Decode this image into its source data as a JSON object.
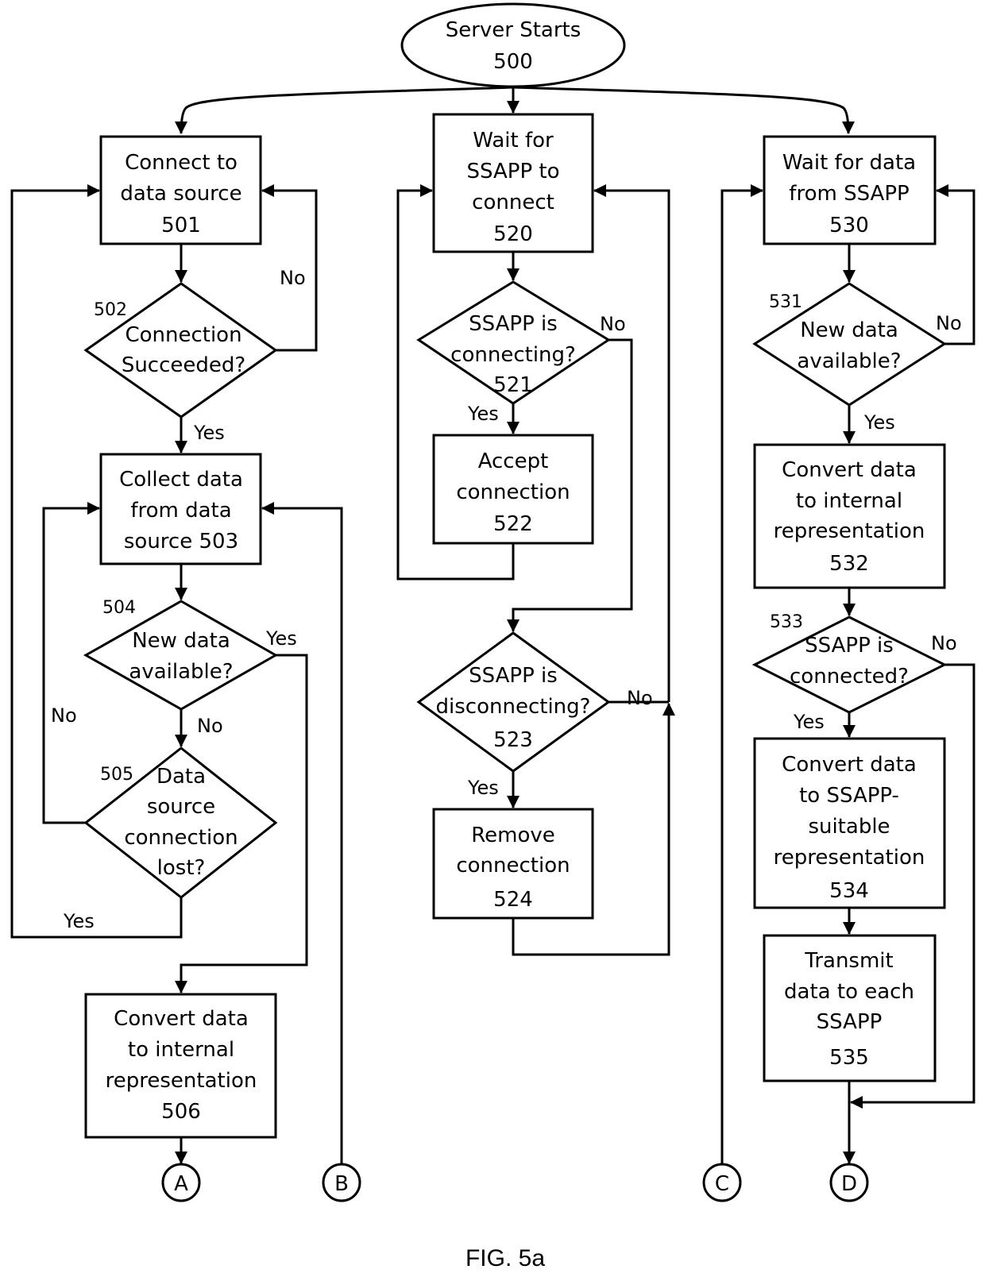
{
  "figure_caption": "FIG. 5a",
  "start": {
    "lines": [
      "Server Starts",
      "500"
    ]
  },
  "nodes": {
    "n501": {
      "lines": [
        "Connect to",
        "data source",
        "501"
      ]
    },
    "n502": {
      "lines": [
        "Connection",
        "Succeeded?"
      ],
      "ref": "502"
    },
    "n503": {
      "lines": [
        "Collect data",
        "from data",
        "source 503"
      ]
    },
    "n504": {
      "lines": [
        "New data",
        "available?"
      ],
      "ref": "504"
    },
    "n505": {
      "lines": [
        "Data",
        "source",
        "connection",
        "lost?"
      ],
      "ref": "505"
    },
    "n506": {
      "lines": [
        "Convert data",
        "to internal",
        "representation",
        "506"
      ]
    },
    "n520": {
      "lines": [
        "Wait for",
        "SSAPP to",
        "connect",
        "520"
      ]
    },
    "n521": {
      "lines": [
        "SSAPP is",
        "connecting?",
        "521"
      ]
    },
    "n522": {
      "lines": [
        "Accept",
        "connection",
        "522"
      ]
    },
    "n523": {
      "lines": [
        "SSAPP is",
        "disconnecting?",
        "523"
      ]
    },
    "n524": {
      "lines": [
        "Remove",
        "connection",
        "524"
      ]
    },
    "n530": {
      "lines": [
        "Wait for data",
        "from SSAPP",
        "530"
      ]
    },
    "n531": {
      "lines": [
        "New data",
        "available?"
      ],
      "ref": "531"
    },
    "n532": {
      "lines": [
        "Convert data",
        "to internal",
        "representation",
        "532"
      ]
    },
    "n533": {
      "lines": [
        "SSAPP is",
        "connected?"
      ],
      "ref": "533"
    },
    "n534": {
      "lines": [
        "Convert data",
        "to SSAPP-",
        "suitable",
        "representation",
        "534"
      ]
    },
    "n535": {
      "lines": [
        "Transmit",
        "data to each",
        "SSAPP",
        "535"
      ]
    }
  },
  "edge_labels": {
    "e502_no": "No",
    "e502_yes": "Yes",
    "e504_yes": "Yes",
    "e504_no": "No",
    "e505_no": "No",
    "e505_yes": "Yes",
    "e521_no": "No",
    "e521_yes": "Yes",
    "e523_no": "No",
    "e523_yes": "Yes",
    "e531_no": "No",
    "e531_yes": "Yes",
    "e533_no": "No",
    "e533_yes": "Yes"
  },
  "connectors": [
    "A",
    "B",
    "C",
    "D"
  ]
}
